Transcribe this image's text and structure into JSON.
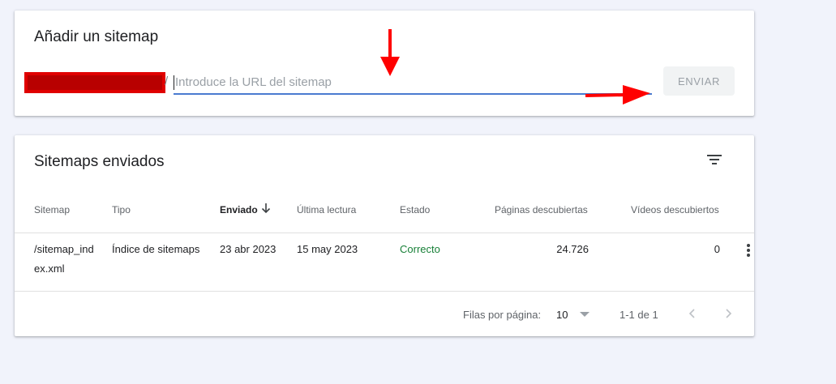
{
  "add_card": {
    "title": "Añadir un sitemap",
    "slash": "/",
    "url_placeholder": "Introduce la URL del sitemap",
    "url_value": "",
    "submit_label": "ENVIAR"
  },
  "list_card": {
    "title": "Sitemaps enviados",
    "columns": [
      "Sitemap",
      "Tipo",
      "Enviado",
      "Última lectura",
      "Estado",
      "Páginas descubiertas",
      "Vídeos descubiertos"
    ],
    "sorted_column": "Enviado",
    "rows": [
      {
        "sitemap": "/sitemap_index.xml",
        "tipo": "Índice de sitemaps",
        "enviado": "23 abr 2023",
        "ultima_lectura": "15 may 2023",
        "estado": "Correcto",
        "paginas": "24.726",
        "videos": "0"
      }
    ],
    "pagination": {
      "rows_per_page_label": "Filas por página:",
      "rows_per_page_value": "10",
      "range": "1-1 de 1"
    }
  },
  "colors": {
    "accent_blue": "#4a7bd0",
    "status_green": "#188038",
    "annotation_red": "#ff0000"
  },
  "icons": [
    "filter-icon",
    "arrow-down-icon",
    "more-vert-icon",
    "chevron-left-icon",
    "chevron-right-icon",
    "dropdown-caret-icon"
  ]
}
